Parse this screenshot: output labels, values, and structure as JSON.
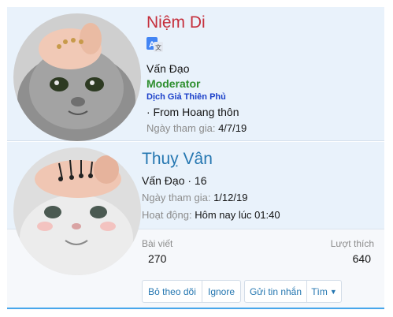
{
  "profile1": {
    "name": "Niệm Di",
    "title": "Vấn Đạo",
    "role": "Moderator",
    "subtitle": "Dịch Giả Thiên Phủ",
    "location": "· From Hoang thôn",
    "joined_label": "Ngày tham gia:",
    "joined_value": "4/7/19",
    "badge_icon": "translate-icon"
  },
  "profile2": {
    "name": "Thuỵ Vân",
    "title": "Vấn Đạo · 16",
    "joined_label": "Ngày tham gia:",
    "joined_value": "1/12/19",
    "activity_label": "Hoạt động:",
    "activity_value": "Hôm nay lúc 01:40",
    "stats": {
      "posts_label": "Bài viết",
      "posts_value": "270",
      "likes_label": "Lượt thích",
      "likes_value": "640"
    },
    "actions": {
      "unfollow": "Bỏ theo dõi",
      "ignore": "Ignore",
      "message": "Gửi tin nhắn",
      "find": "Tìm"
    }
  },
  "colors": {
    "card_bg": "#e9f2fb",
    "name1": "#c52f3c",
    "name2": "#2577b1",
    "moderator": "#2d8e2d",
    "accent": "#47a7eb"
  }
}
